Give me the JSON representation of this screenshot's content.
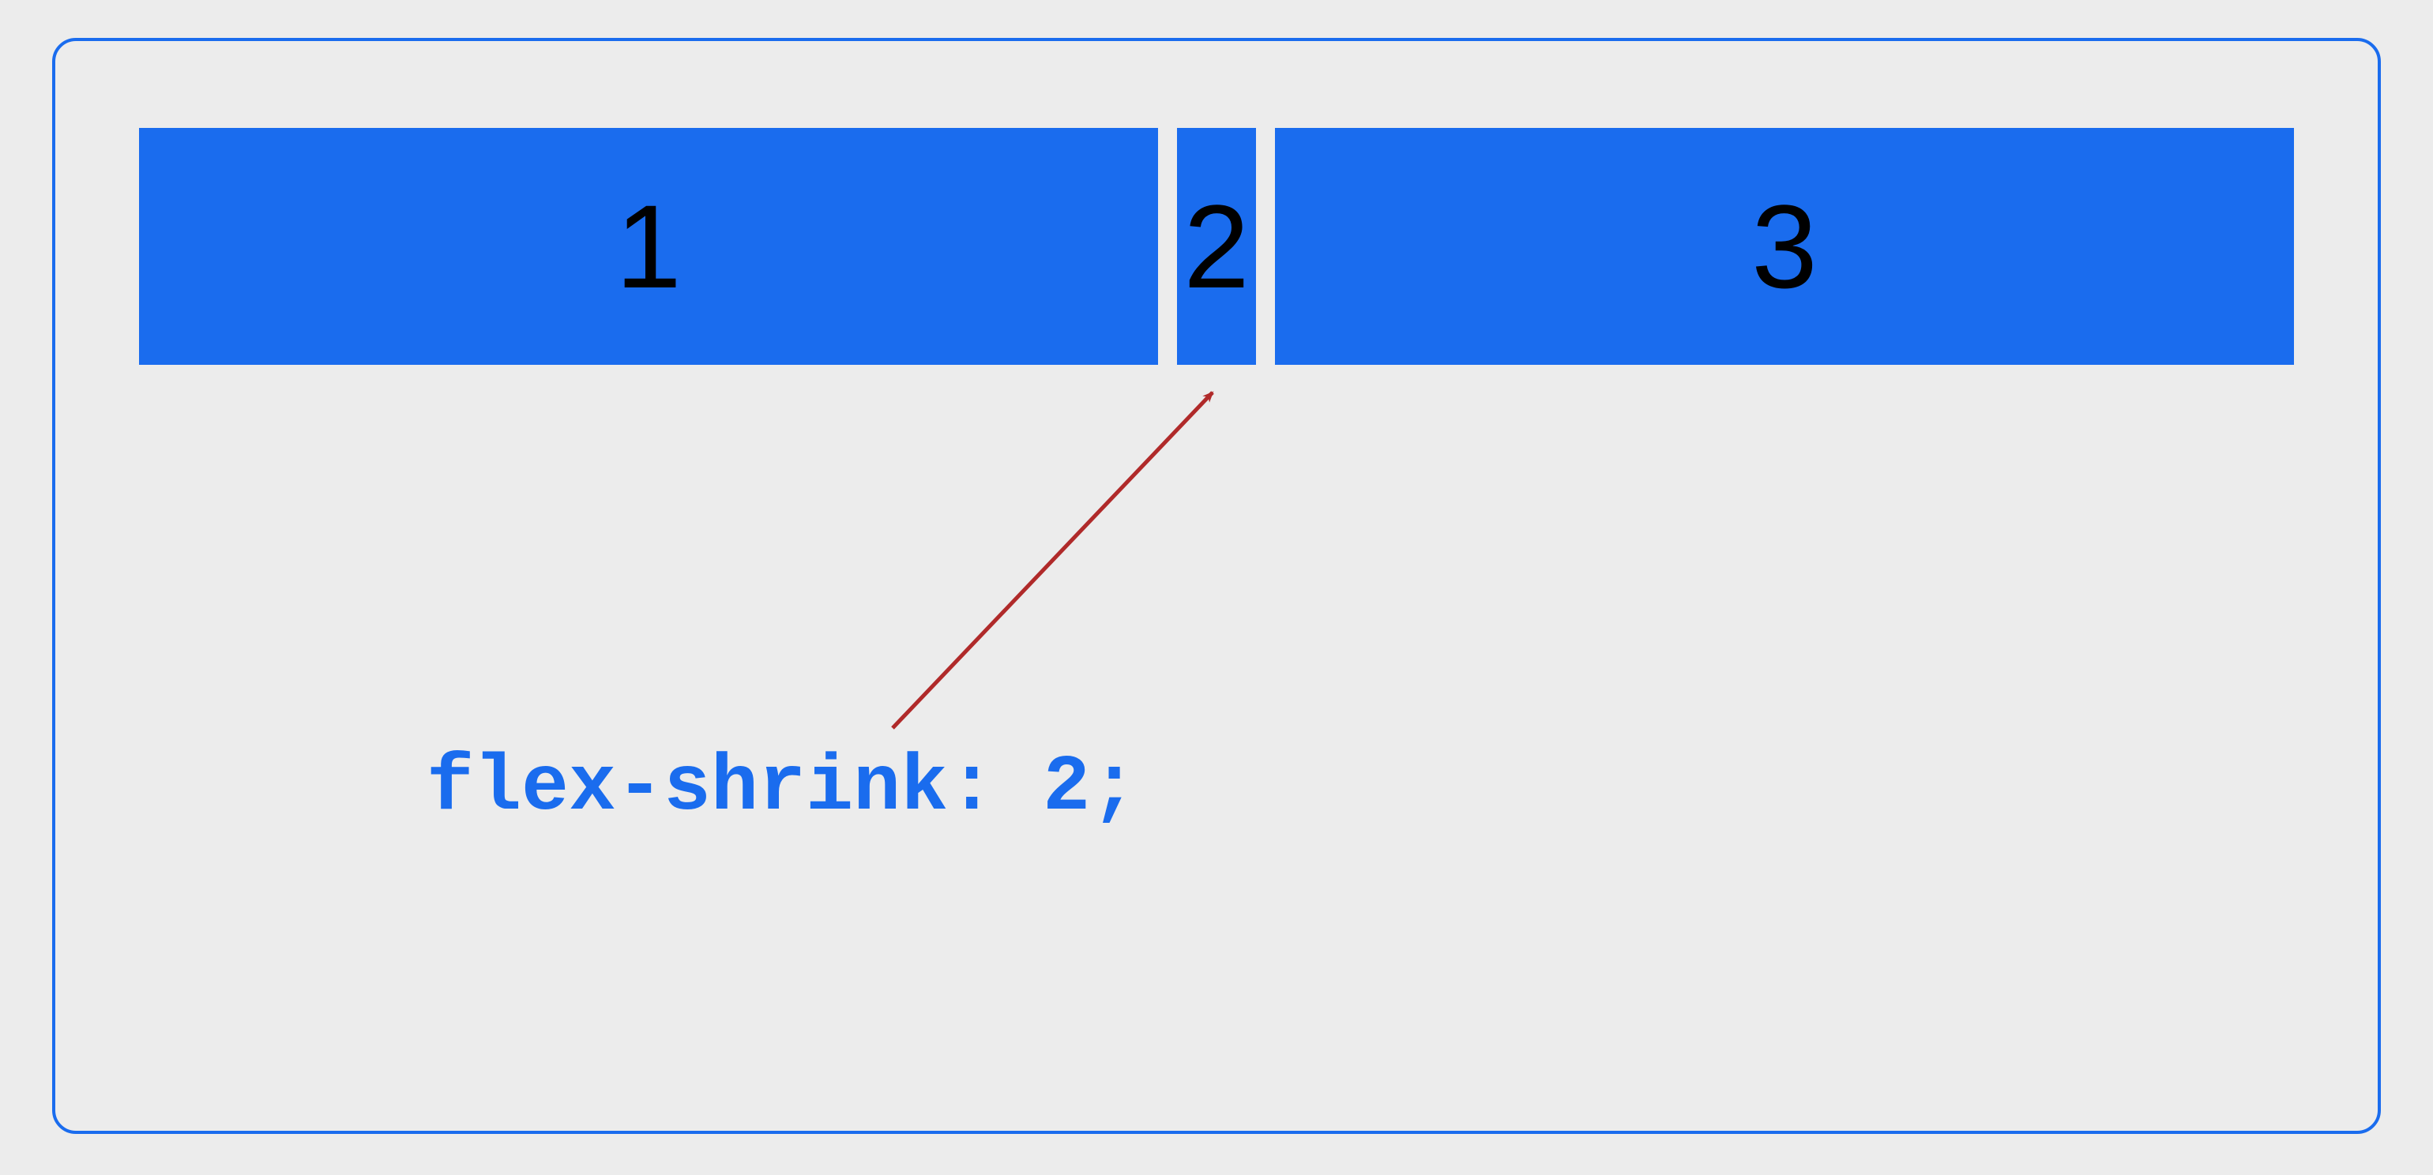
{
  "diagram": {
    "items": [
      {
        "label": "1"
      },
      {
        "label": "2"
      },
      {
        "label": "3"
      }
    ],
    "annotation": "flex-shrink: 2;"
  }
}
